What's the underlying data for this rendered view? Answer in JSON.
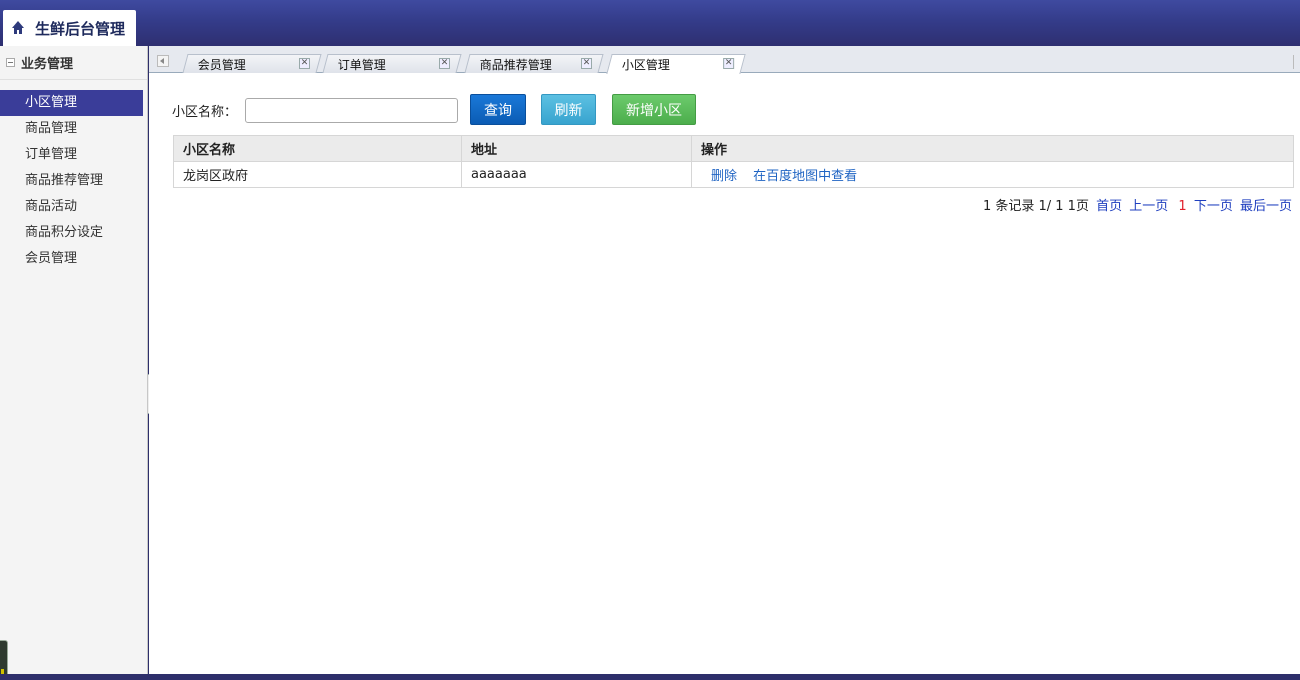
{
  "header": {
    "title": "生鲜后台管理",
    "home_icon": "home-icon"
  },
  "sidebar": {
    "section_title": "业务管理",
    "items": [
      {
        "label": "小区管理",
        "active": true
      },
      {
        "label": "商品管理"
      },
      {
        "label": "订单管理"
      },
      {
        "label": "商品推荐管理"
      },
      {
        "label": "商品活动"
      },
      {
        "label": "商品积分设定"
      },
      {
        "label": "会员管理"
      }
    ]
  },
  "tabs": [
    {
      "label": "会员管理"
    },
    {
      "label": "订单管理"
    },
    {
      "label": "商品推荐管理"
    },
    {
      "label": "小区管理",
      "active": true
    }
  ],
  "search": {
    "label": "小区名称：",
    "value": "",
    "placeholder": ""
  },
  "buttons": {
    "query": "查询",
    "refresh": "刷新",
    "add": "新增小区"
  },
  "table": {
    "columns": [
      "小区名称",
      "地址",
      "操作"
    ],
    "rows": [
      {
        "name": "龙岗区政府",
        "address": "aaaaaaa",
        "ops": [
          "删除",
          "在百度地图中查看"
        ]
      }
    ]
  },
  "pager": {
    "summary": "1 条记录 1/ 1 1页",
    "first": "首页",
    "prev": "上一页",
    "current": "1",
    "next": "下一页",
    "last": "最后一页"
  },
  "colors": {
    "accent": "#3a3d99",
    "header": "#343c8a",
    "query": "#0b5cb4",
    "refresh": "#38a4cf",
    "add": "#4cae4c"
  }
}
